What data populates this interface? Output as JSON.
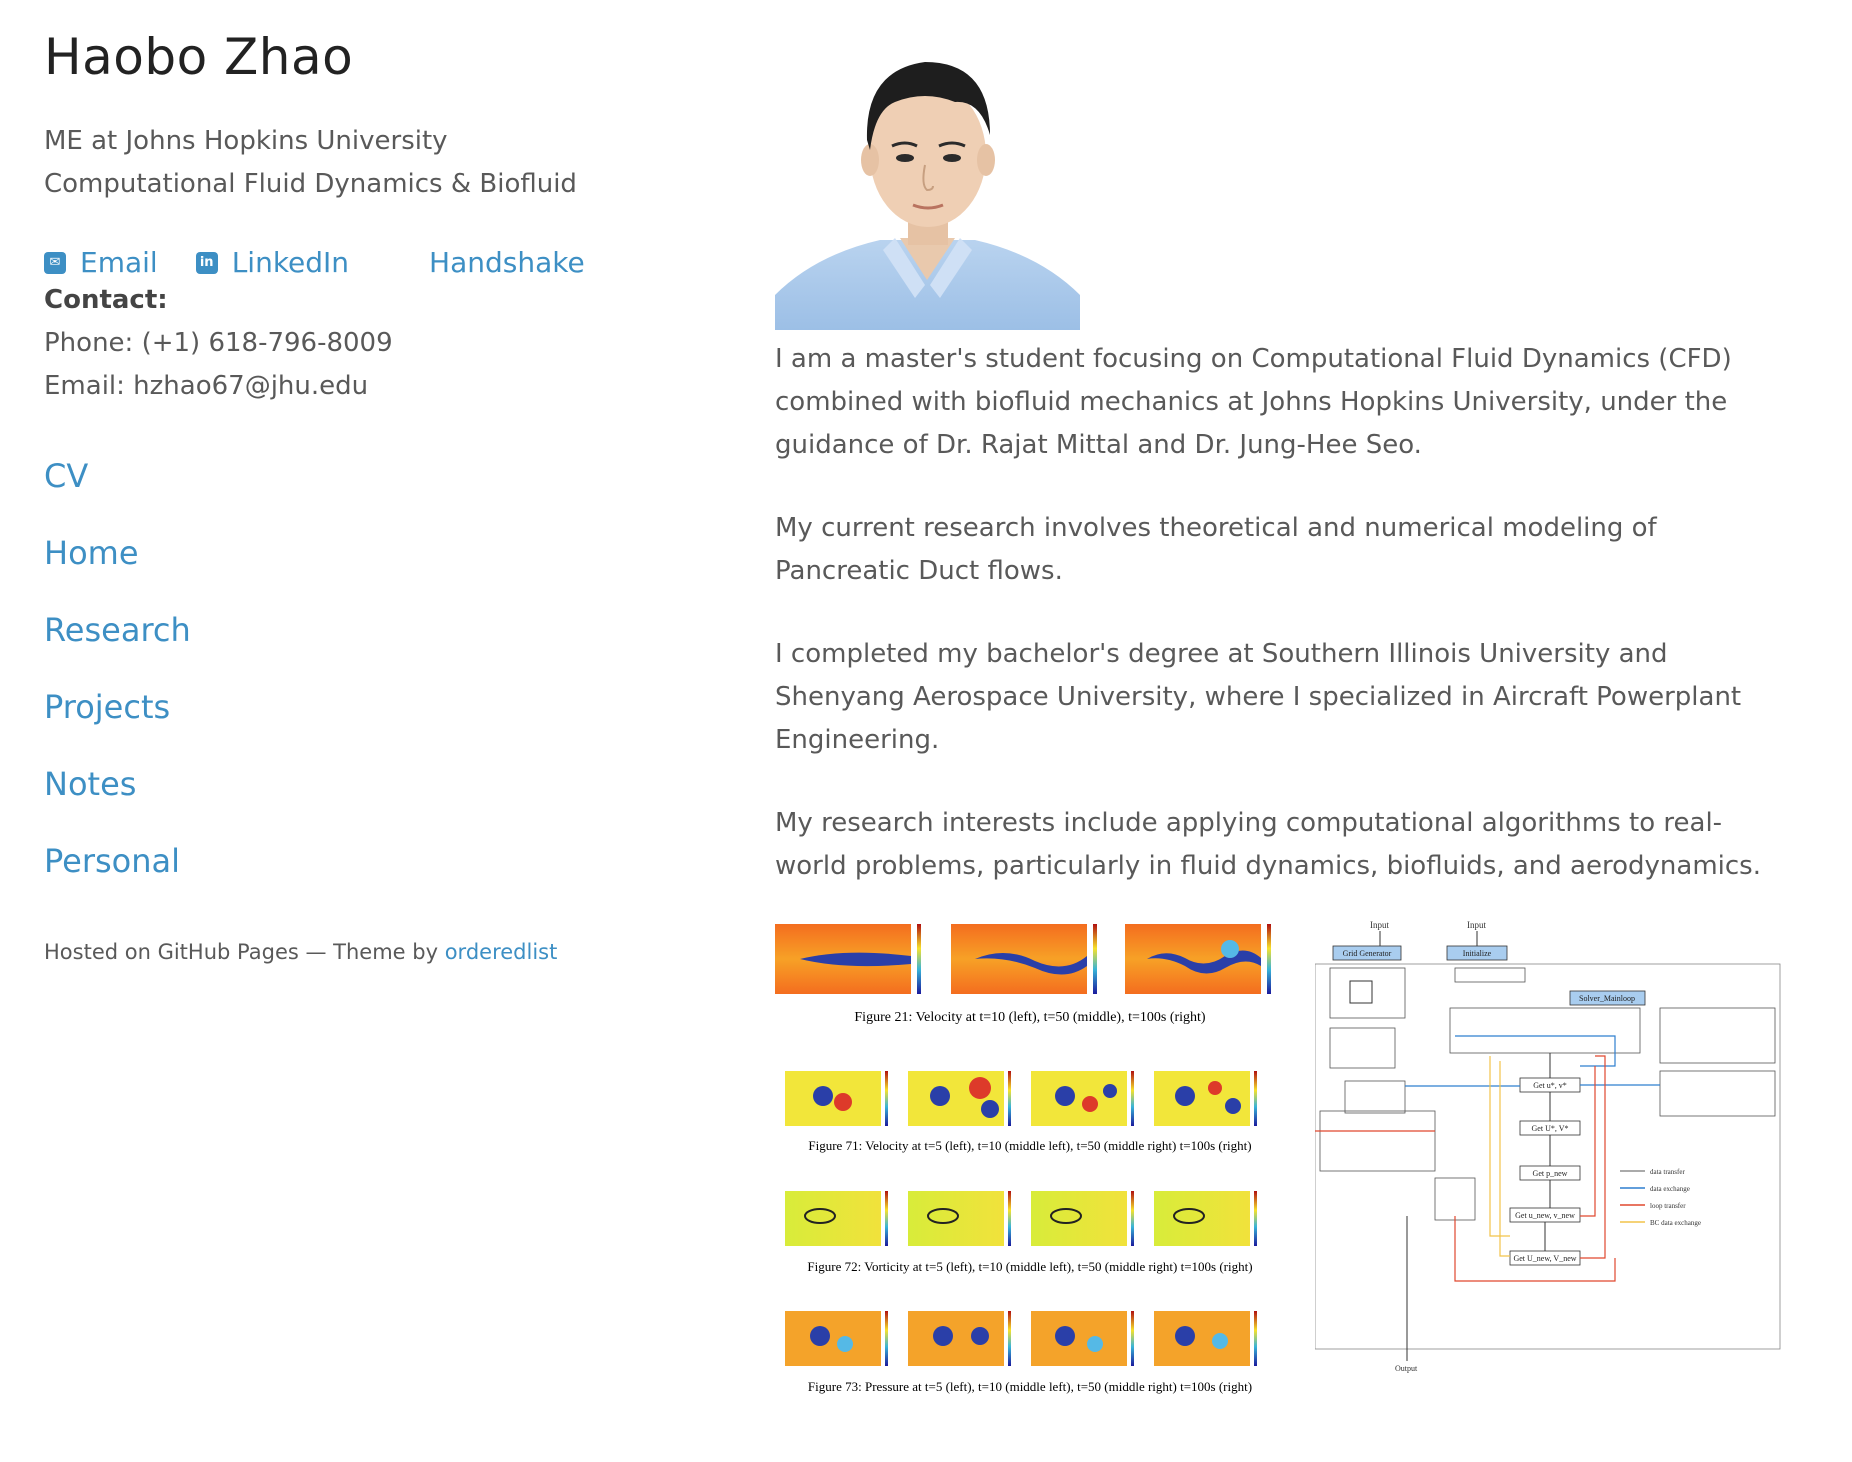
{
  "profile": {
    "name": "Haobo Zhao",
    "tagline_line1": "ME at Johns Hopkins University",
    "tagline_line2": "Computational Fluid Dynamics & Biofluid"
  },
  "links": {
    "email_label": "Email",
    "linkedin_label": "LinkedIn",
    "handshake_label": "Handshake"
  },
  "contact": {
    "heading": "Contact:",
    "phone": "Phone: (+1) 618-796-8009",
    "email": "Email: hzhao67@jhu.edu"
  },
  "nav": {
    "items": [
      "CV",
      "Home",
      "Research",
      "Projects",
      "Notes",
      "Personal"
    ]
  },
  "footer": {
    "prefix": "Hosted on GitHub Pages — Theme by ",
    "link": "orderedlist"
  },
  "main": {
    "paragraphs": [
      "I am a master's student focusing on Computational Fluid Dynamics (CFD) combined with biofluid mechanics at Johns Hopkins University, under the guidance of Dr. Rajat Mittal and Dr. Jung-Hee Seo.",
      "My current research involves theoretical and numerical modeling of Pancreatic Duct flows.",
      "I completed my bachelor's degree at Southern Illinois University and Shenyang Aerospace University, where I specialized in Aircraft Powerplant Engineering.",
      "My research interests include applying computational algorithms to real-world problems, particularly in fluid dynamics, biofluids, and aerodynamics."
    ]
  },
  "figures": {
    "fig21": "Figure 21: Velocity at t=10 (left), t=50 (middle), t=100s (right)",
    "fig71": "Figure 71: Velocity at t=5 (left), t=10 (middle left), t=50 (middle right) t=100s (right)",
    "fig72": "Figure 72: Vorticity at t=5 (left), t=10 (middle left), t=50 (middle right) t=100s (right)",
    "fig73": "Figure 73: Pressure at t=5 (left), t=10 (middle left), t=50 (middle right) t=100s (right)"
  },
  "flowchart": {
    "input1": "Input",
    "input2": "Input",
    "grid_generator": "Grid Generator",
    "initialize": "Initialize",
    "solver_mainloop": "Solver_Mainloop",
    "get_uv": "Get u*, v*",
    "get_UV": "Get U*, V*",
    "get_pnew": "Get p_new",
    "get_unew": "Get u_new, v_new",
    "get_Unew": "Get U_new, V_new",
    "output": "Output",
    "legend": [
      "data transfer",
      "data exchange",
      "loop transfer",
      "BC data exchange"
    ]
  },
  "colors": {
    "link": "#3d8fc4",
    "text": "#595959",
    "heading": "#222222"
  }
}
